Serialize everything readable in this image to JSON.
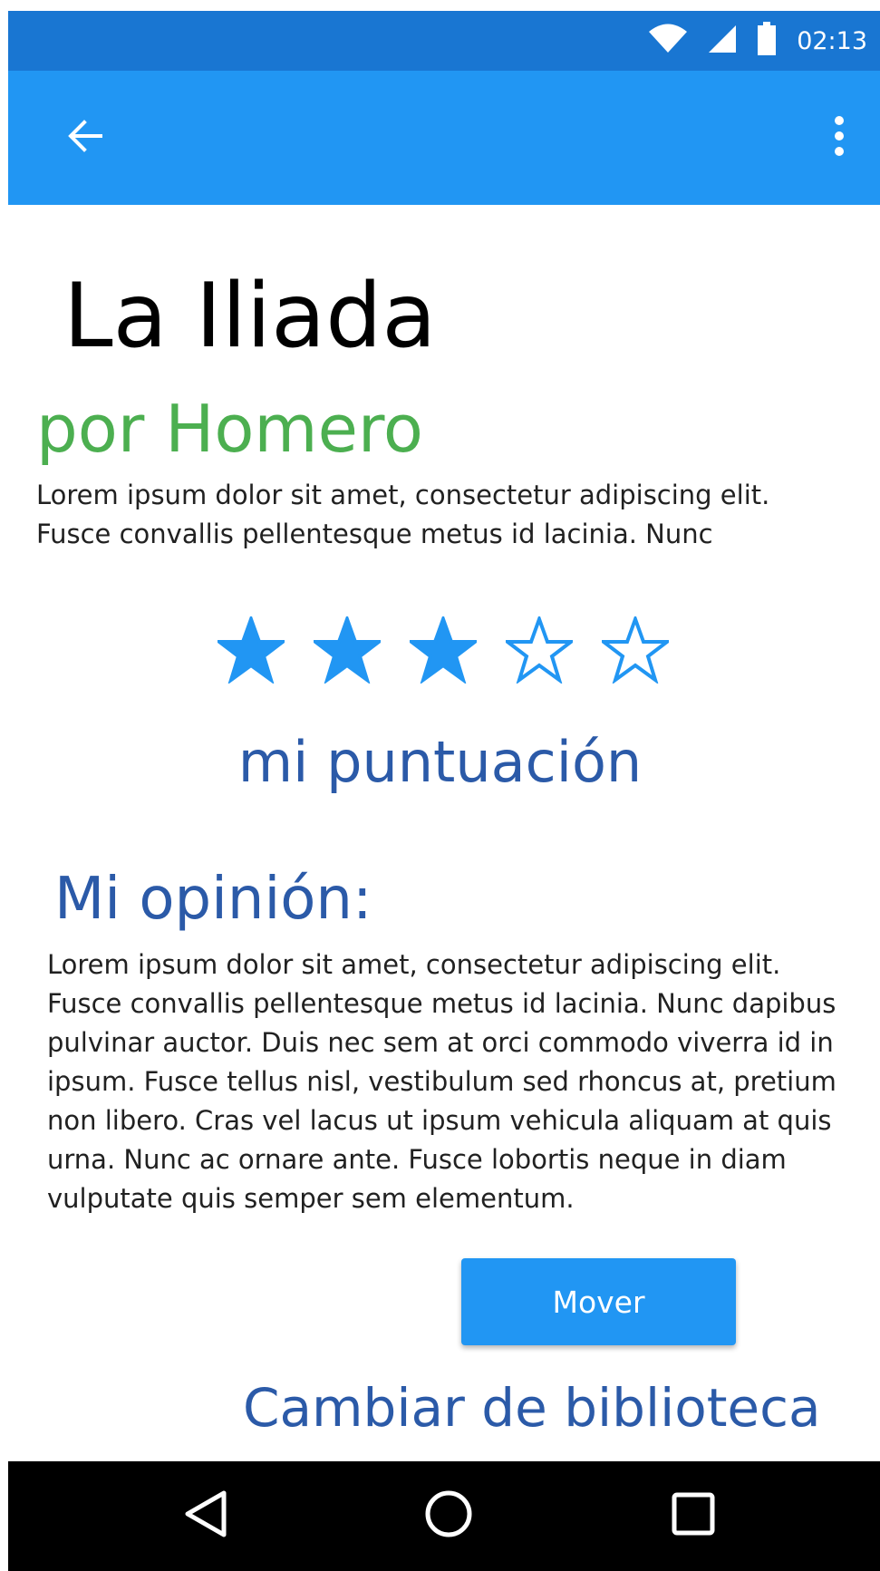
{
  "status_bar": {
    "time": "02:13",
    "icons": [
      "wifi-icon",
      "cell-signal-icon",
      "battery-icon"
    ]
  },
  "app_bar": {
    "back_icon": "arrow-back-icon",
    "menu_icon": "more-vert-icon"
  },
  "book": {
    "title": "La Iliada",
    "author": "por Homero",
    "description": "Lorem ipsum dolor sit amet, consectetur adipiscing elit. Fusce convallis pellentesque metus id lacinia. Nunc"
  },
  "rating": {
    "value": 3,
    "max": 5,
    "label": "mi puntuación"
  },
  "opinion": {
    "heading": "Mi opinión:",
    "text": "Lorem ipsum dolor sit amet, consectetur adipiscing elit. Fusce convallis pellentesque metus id lacinia. Nunc dapibus pulvinar auctor. Duis nec sem at orci commodo viverra id in ipsum. Fusce tellus nisl, vestibulum sed rhoncus at, pretium non libero. Cras vel lacus ut ipsum vehicula aliquam at quis urna. Nunc ac ornare ante. Fusce lobortis neque in diam vulputate quis semper sem elementum."
  },
  "actions": {
    "move_label": "Mover",
    "change_library_label": "Cambiar de biblioteca"
  },
  "nav_bar": {
    "icons": [
      "back-triangle-icon",
      "home-circle-icon",
      "recents-square-icon"
    ]
  },
  "colors": {
    "status_bar": "#1976d2",
    "app_bar": "#2196f3",
    "author": "#4caf50",
    "accent_text": "#2b5aa8",
    "star": "#2196f3"
  }
}
